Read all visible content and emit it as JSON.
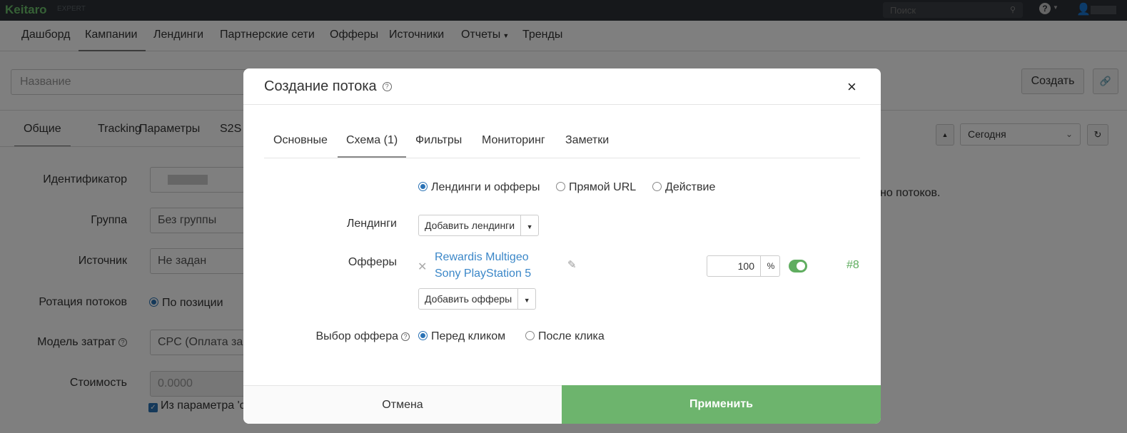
{
  "topbar": {
    "logo": "Keitaro",
    "edition": "EXPERT",
    "search_placeholder": "Поиск",
    "help_icon": "question-circle-icon",
    "user_icon": "user-icon"
  },
  "nav": {
    "items": [
      {
        "label": "Дашборд"
      },
      {
        "label": "Кампании",
        "active": true
      },
      {
        "label": "Лендинги"
      },
      {
        "label": "Партнерские сети"
      },
      {
        "label": "Офферы"
      },
      {
        "label": "Источники"
      },
      {
        "label": "Отчеты",
        "dropdown": true
      },
      {
        "label": "Тренды"
      }
    ]
  },
  "campaign": {
    "name_placeholder": "Название",
    "create_label": "Создать",
    "link_icon": "link-icon",
    "tabs": [
      "Общие",
      "Tracking",
      "Параметры",
      "S2S"
    ],
    "period": "Сегодня",
    "no_streams_text": "но потоков.",
    "fields": {
      "id_label": "Идентификатор",
      "group_label": "Группа",
      "group_value": "Без группы",
      "source_label": "Источник",
      "source_value": "Не задан",
      "rotation_label": "Ротация потоков",
      "rotation_value": "По позиции",
      "cost_model_label": "Модель затрат",
      "cost_model_value": "CPC (Оплата за к",
      "cost_label": "Стоимость",
      "cost_value": "0.0000",
      "cost_param_label": "Из параметра 'c"
    }
  },
  "modal": {
    "title": "Создание потока",
    "close_label": "×",
    "tabs": [
      {
        "label": "Основные"
      },
      {
        "label": "Схема (1)",
        "active": true
      },
      {
        "label": "Фильтры"
      },
      {
        "label": "Мониторинг"
      },
      {
        "label": "Заметки"
      }
    ],
    "schema_options": [
      {
        "label": "Лендинги и офферы",
        "selected": true
      },
      {
        "label": "Прямой URL",
        "selected": false
      },
      {
        "label": "Действие",
        "selected": false
      }
    ],
    "landings_label": "Лендинги",
    "add_landings_label": "Добавить лендинги",
    "offers_label": "Офферы",
    "offer": {
      "name_line1": "Rewardis Multigeo",
      "name_line2": "Sony PlayStation 5",
      "share": "100",
      "share_unit": "%",
      "enabled": true,
      "number": "#8"
    },
    "add_offers_label": "Добавить офферы",
    "offer_choice_label": "Выбор оффера",
    "offer_choice_options": [
      {
        "label": "Перед кликом",
        "selected": true
      },
      {
        "label": "После клика",
        "selected": false
      }
    ],
    "cancel_label": "Отмена",
    "apply_label": "Применить",
    "colors": {
      "accent_green": "#6db46d",
      "link_blue": "#3b87c8",
      "radio_blue": "#2a72b5"
    }
  }
}
